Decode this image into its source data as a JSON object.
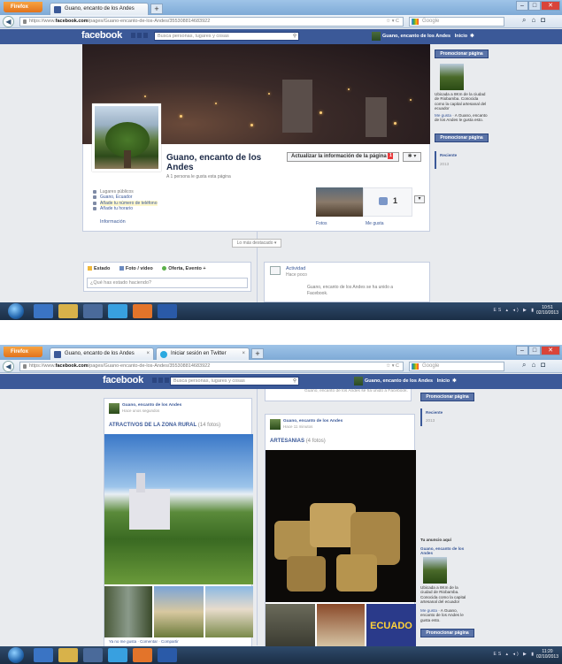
{
  "browser": {
    "firefox_label": "Firefox",
    "tab1": "Guano, encanto de los Andes",
    "tab2": "Iniciar sesión en Twitter",
    "new_tab": "+",
    "url_prefix": "https://www.",
    "url_domain": "facebook.com",
    "url_rest": "/pages/Guano-encanto-de-los-Andes/355308814683922",
    "search_engine": "Google",
    "controls": "☆ ▾ C"
  },
  "fb": {
    "logo": "facebook",
    "search_placeholder": "Busca personas, lugares y cosas",
    "user_name": "Guano, encanto de los Andes",
    "home": "Inicio",
    "page_title": "Guano, encanto de los Andes",
    "likes_text": "A 1 persona le gusta esta página",
    "update_btn": "Actualizar la información de la página",
    "update_badge": "1",
    "info_items": [
      "Lugares públicos",
      "Guano, Ecuador",
      "Añade tu número de teléfono",
      "Añade tu horario"
    ],
    "info_tab": "Información",
    "photos_label": "Fotos",
    "likes_label": "Me gusta",
    "like_count": "1",
    "highlights": "Lo más destacado ▾",
    "composer_tabs": [
      "Estado",
      "Foto / vídeo",
      "Oferta, Evento +"
    ],
    "composer_placeholder": "¿Qué has estado haciendo?",
    "activity_title": "Actividad",
    "activity_sub": "Hace poco",
    "activity_msg": "Guano, encanto de los Andes se ha unido a Facebook.",
    "promote": "Promocionar página",
    "rail_desc": "Ubicada a 8Km de la ciudad de Riobamba. Conocida como la capital artesanal del ecuador",
    "rail_like": "Me gusta",
    "rail_like_text": "· A Guano, encanto de los Andes le gusta esto.",
    "recent": "Reciente",
    "year": "2013",
    "ad_label": "Tu anuncio aquí",
    "ad_name": "Guano, encanto de los Andes"
  },
  "posts": {
    "left_name": "Guano, encanto de los Andes",
    "left_time": "Hace unos segundos",
    "left_album": "ATRACTIVOS DE LA ZONA RURAL",
    "left_count": "(14 fotos)",
    "left_footer": "Ya no me gusta · Comentar · Compartir",
    "right_name": "Guano, encanto de los Andes",
    "right_time": "Hace 11 minutos",
    "right_album": "ARTESANIAS",
    "right_count": "(4 fotos)",
    "ecuador_text": "ECUADO",
    "top_msg": "Guano, encanto de los Andes se ha unido a Facebook."
  },
  "taskbar": {
    "time1": "10:51",
    "date1": "02/10/2013",
    "time2": "11:20",
    "date2": "02/10/2013",
    "tray": "ES ▴ ◂) ▶ ▮"
  }
}
